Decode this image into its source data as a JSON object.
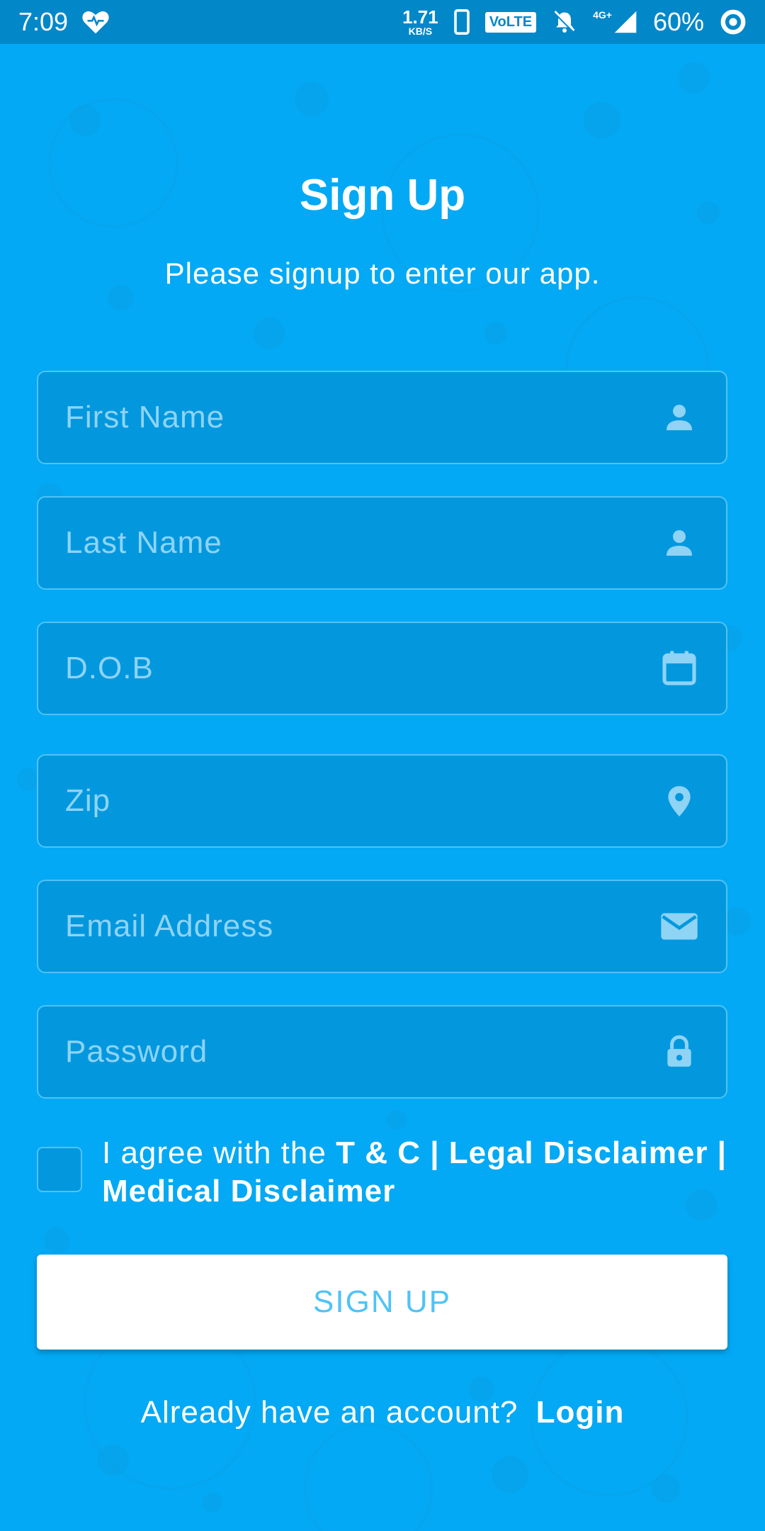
{
  "status_bar": {
    "time": "7:09",
    "speed_value": "1.71",
    "speed_unit": "KB/S",
    "volte_label": "VoLTE",
    "network_label": "4G+",
    "battery": "60%",
    "icons": [
      "heart-icon",
      "phone-icon",
      "mute-bell-icon",
      "signal-icon",
      "battery-saver-icon"
    ]
  },
  "header": {
    "title": "Sign Up",
    "subtitle": "Please signup to enter our app."
  },
  "form": {
    "fields": [
      {
        "placeholder": "First Name",
        "value": "",
        "icon": "person-icon"
      },
      {
        "placeholder": "Last Name",
        "value": "",
        "icon": "person-icon"
      },
      {
        "placeholder": "D.O.B",
        "value": "",
        "icon": "calendar-icon"
      },
      {
        "placeholder": "Zip",
        "value": "",
        "icon": "location-pin-icon"
      },
      {
        "placeholder": "Email Address",
        "value": "",
        "icon": "mail-icon"
      },
      {
        "placeholder": "Password",
        "value": "",
        "icon": "lock-icon"
      }
    ],
    "agree": {
      "checked": false,
      "prefix": "I agree with the",
      "links": "T & C | Legal Disclaimer | Medical Disclaimer"
    },
    "submit_label": "SIGN UP"
  },
  "footer": {
    "prompt": "Already have an account?",
    "login_label": "Login"
  },
  "colors": {
    "background": "#03a9f4",
    "status_bar": "#0288c9",
    "field_fill": "#0398de",
    "field_border": "#4fc3f7",
    "placeholder": "#8fd3f5",
    "button_text": "#4fc3f7"
  }
}
